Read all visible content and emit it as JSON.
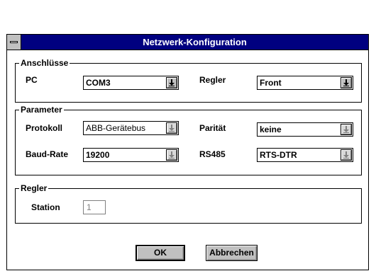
{
  "dialog": {
    "title": "Netzwerk-Konfiguration"
  },
  "anschluesse": {
    "legend": "Anschlüsse",
    "pc_label": "PC",
    "pc_value": "COM3",
    "regler_label": "Regler",
    "regler_value": "Front"
  },
  "parameter": {
    "legend": "Parameter",
    "protokoll_label": "Protokoll",
    "protokoll_value": "ABB-Gerätebus",
    "paritaet_label": "Parität",
    "paritaet_value": "keine",
    "baudrate_label": "Baud-Rate",
    "baudrate_value": "19200",
    "rs485_label": "RS485",
    "rs485_value": "RTS-DTR"
  },
  "regler": {
    "legend": "Regler",
    "station_label": "Station",
    "station_value": "1"
  },
  "buttons": {
    "ok": "OK",
    "cancel": "Abbrechen"
  },
  "icons": {
    "system_menu": "system-menu-icon",
    "dropdown": "dropdown-arrow-icon"
  }
}
